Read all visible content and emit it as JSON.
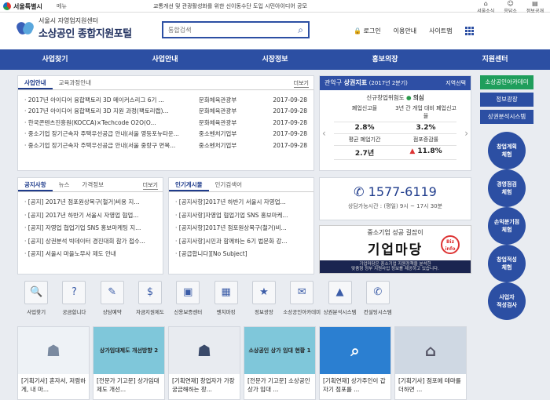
{
  "topbar": {
    "city": "서울특별시",
    "lang": "메뉴",
    "notice": "교통개선 및 관광활성화를 위한 신이동수단 도입 시민아이디어 공모",
    "icons": [
      {
        "icon": "house-icon",
        "label": "서울소식"
      },
      {
        "icon": "people-icon",
        "label": "응답소"
      },
      {
        "icon": "doc-icon",
        "label": "정보공개"
      }
    ]
  },
  "brand": {
    "sub": "서울시 자영업지원센터",
    "main": "소상공인 종합지원포털"
  },
  "search": {
    "placeholder": "통합검색"
  },
  "header_links": {
    "login": "로그인",
    "join": "이용안내",
    "sitemap": "사이트맵"
  },
  "nav": [
    "사업찾기",
    "사업안내",
    "시장정보",
    "홍보의장",
    "지원센터"
  ],
  "biz": {
    "tabs": [
      "사업안내",
      "교육과정안내"
    ],
    "more": "더보기",
    "rows": [
      {
        "title": "2017년 아이디어 융합팩토리 3D 메이커스리그 6기 ...",
        "org": "문화체육관광부",
        "date": "2017-09-28"
      },
      {
        "title": "2017년 아이디어 융합팩토리 3D 지원 과정(팩토리랩)...",
        "org": "문화체육관광부",
        "date": "2017-09-28"
      },
      {
        "title": "한국콘텐츠진흥원(KOCCA)×Techcode O2O(O...",
        "org": "문화체육관광부",
        "date": "2017-09-28"
      },
      {
        "title": "중소기업 장기근속자 주택우선공급 안내(서울 영등포뉴타운...",
        "org": "중소벤처기업부",
        "date": "2017-09-28"
      },
      {
        "title": "중소기업 장기근속자 주택우선공급 안내(서울 중랑구 면목...",
        "org": "중소벤처기업부",
        "date": "2017-09-28"
      }
    ]
  },
  "notice": {
    "tabs": [
      "공지사항",
      "뉴스",
      "가격정보"
    ],
    "more": "더보기",
    "rows": [
      "[공지] 2017년 점포원상복구(철거)비용 지...",
      "[공지] 2017년 하반기 서울시 자영업 협업...",
      "[공지] 자영업 협업기업 SNS 홍보마케팅 지...",
      "[공지] 상권분석 빅데이터 경진대회 참가 접수...",
      "[공지] 서울시 마을노무사 제도 안내"
    ]
  },
  "popular": {
    "tabs": [
      "인기게시물",
      "인기검색어"
    ],
    "rows": [
      "[공지사항]2017년 하반기 서울시 자영업...",
      "[공지사항]자영업 협업기업 SNS 홍보마케...",
      "[공지사항]2017년 점포원상복구(철거)비...",
      "[공지사항]시민과 함께하는 6기 법문화 강...",
      "[공급합니다][No Subject]"
    ]
  },
  "stats": {
    "region": "관악구",
    "title": "상권지표",
    "year": "(2017년 2분기)",
    "more": "지역선택",
    "growth_label": "신규창업위험도",
    "growth_value": "의심",
    "cells": [
      {
        "label": "폐업신고율",
        "value": "2.8%"
      },
      {
        "label": "3년 간 개업 대비 폐업신고율",
        "value": "3.2%"
      },
      {
        "label": "평균 폐업기간",
        "value": "2.7년"
      },
      {
        "label": "점포증감률",
        "value": "11.8%"
      }
    ]
  },
  "contact": {
    "phone": "1577-6119",
    "hours": "상담가능시간 : (평일) 9시 ~ 17시 30분"
  },
  "banner": {
    "top": "중소기업 성공 길잡이",
    "main": "기업마당",
    "logo": "Biz info",
    "desc1": "기업마당은 중소기업 지원정책을 분석한",
    "desc2": "맞춤형 정부 지원사업 정보를 제공하고 있습니다."
  },
  "side_buttons": [
    {
      "label": "소상공인아카데미",
      "color": "#1f9e5c"
    },
    {
      "label": "정보광장",
      "color": "#2c4fa3"
    },
    {
      "label": "상권분석시스템",
      "color": "#2c4fa3"
    }
  ],
  "side_circles": [
    "창업계획\n체험",
    "경영점검\n체험",
    "손익분기점\n체험",
    "창업적성\n체험",
    "사업자\n적성검사"
  ],
  "icons": [
    {
      "icon": "search-icon",
      "glyph": "🔍",
      "label": "사업찾기"
    },
    {
      "icon": "question-icon",
      "glyph": "?",
      "label": "궁금합니다"
    },
    {
      "icon": "consult-icon",
      "glyph": "✎",
      "label": "상담예약"
    },
    {
      "icon": "money-icon",
      "glyph": "$",
      "label": "자금지원제도"
    },
    {
      "icon": "guarantee-icon",
      "glyph": "▣",
      "label": "신용보증센터"
    },
    {
      "icon": "benchmark-icon",
      "glyph": "▦",
      "label": "벤치마킹"
    },
    {
      "icon": "info-icon",
      "glyph": "★",
      "label": "정보광장"
    },
    {
      "icon": "academy-icon",
      "glyph": "✉",
      "label": "소상공인아카데미"
    },
    {
      "icon": "analysis-icon",
      "glyph": "▲",
      "label": "상권분석시스템"
    },
    {
      "icon": "consult-system-icon",
      "glyph": "✆",
      "label": "컨설팅시스템"
    }
  ],
  "cards": [
    {
      "caption": "[기획기사] 혼자서, 저렴하게, 내 마...",
      "img_text": "",
      "bg": "#eef2f6"
    },
    {
      "caption": "[전문가 기고문] 상가임대 제도 개선...",
      "img_text": "상가임대제도 개선방향 2",
      "bg": "#7fc7da"
    },
    {
      "caption": "[기획연재] 창업자가 가장 궁금해하는 창...",
      "img_text": "",
      "bg": "#e8ebf0"
    },
    {
      "caption": "[전문가 기고문] 소상공인 상가 임대 ...",
      "img_text": "소상공인 상가 임대 현황 1",
      "bg": "#7fc7da"
    },
    {
      "caption": "[기획연재] 상가주인이 갑자기 점포를 ...",
      "img_text": "",
      "bg": "#2b7fd1"
    },
    {
      "caption": "[기획기사] 점포에 테마를 더하면 ...",
      "img_text": "",
      "bg": "#cfd8e3"
    }
  ]
}
